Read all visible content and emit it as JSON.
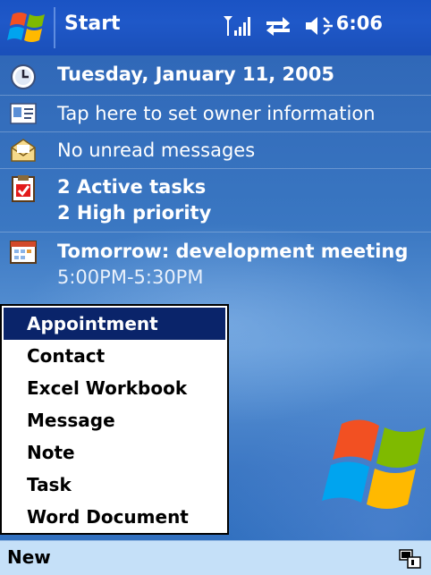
{
  "titlebar": {
    "start_label": "Start",
    "time": "6:06",
    "icons": [
      "windows-flag-icon",
      "signal-icon",
      "connectivity-icon",
      "volume-icon"
    ]
  },
  "today": {
    "date": "Tuesday, January 11, 2005",
    "owner_info": "Tap here to set owner information",
    "messages": "No unread messages",
    "tasks_line1": "2 Active tasks",
    "tasks_line2": "2 High priority",
    "appointment_title": "Tomorrow: development meeting",
    "appointment_time": "5:00PM-5:30PM"
  },
  "new_menu": {
    "items": [
      "Appointment",
      "Contact",
      "Excel Workbook",
      "Message",
      "Note",
      "Task",
      "Word Document"
    ],
    "selected": "Appointment"
  },
  "commandbar": {
    "new_label": "New"
  },
  "colors": {
    "titlebar": "#1f58c8",
    "background": "#3a77c2",
    "menu_selected": "#0a246a",
    "commandbar": "#c5e0f8"
  }
}
